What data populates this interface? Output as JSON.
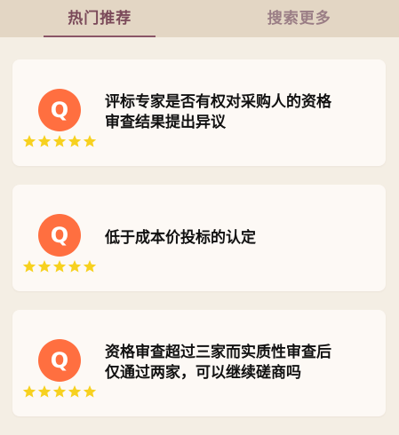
{
  "tabs": [
    {
      "label": "热门推荐",
      "active": true
    },
    {
      "label": "搜索更多",
      "active": false
    }
  ],
  "colors": {
    "tabbar_bg": "#e3d6c4",
    "page_bg": "#f4eee4",
    "card_bg": "#fdf9f5",
    "accent": "#7b4a5a",
    "avatar_bg": "#ff6f40",
    "star": "#f7d11f"
  },
  "items": [
    {
      "avatar_letter": "Q",
      "rating": 5,
      "title_lines": [
        "评标专家是否有权对采购人的资格",
        "审查结果提出异议"
      ]
    },
    {
      "avatar_letter": "Q",
      "rating": 5,
      "title_lines": [
        "低于成本价投标的认定"
      ]
    },
    {
      "avatar_letter": "Q",
      "rating": 5,
      "title_lines": [
        "资格审查超过三家而实质性审查后",
        "仅通过两家，可以继续磋商吗"
      ]
    }
  ]
}
